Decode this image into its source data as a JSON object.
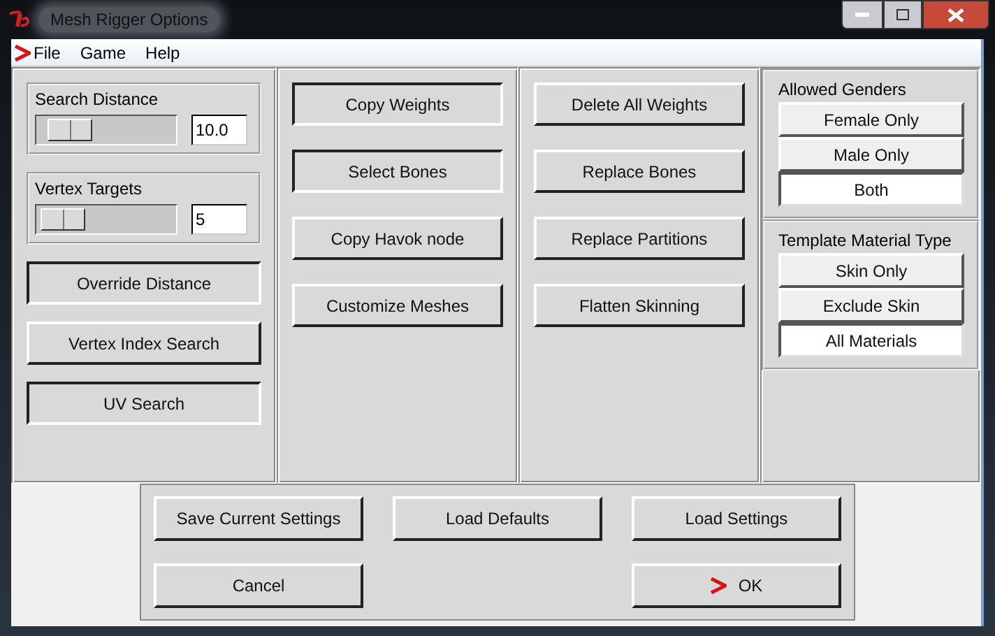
{
  "window": {
    "title": "Mesh Rigger Options"
  },
  "menu": [
    "File",
    "Game",
    "Help"
  ],
  "sliders": [
    {
      "label": "Search Distance",
      "value": "10.0"
    },
    {
      "label": "Vertex Targets",
      "value": "5"
    }
  ],
  "left_buttons": [
    {
      "label": "Override Distance",
      "pressed": true
    },
    {
      "label": "Vertex Index Search",
      "pressed": false
    },
    {
      "label": "UV Search",
      "pressed": true
    }
  ],
  "column_2": [
    {
      "label": "Copy Weights",
      "pressed": true
    },
    {
      "label": "Select Bones",
      "pressed": true
    },
    {
      "label": "Copy Havok node",
      "pressed": false
    },
    {
      "label": "Customize Meshes",
      "pressed": false
    }
  ],
  "column_3": [
    {
      "label": "Delete All Weights",
      "pressed": false
    },
    {
      "label": "Replace Bones",
      "pressed": false
    },
    {
      "label": "Replace Partitions",
      "pressed": false
    },
    {
      "label": "Flatten Skinning",
      "pressed": false
    }
  ],
  "option_groups": [
    {
      "title": "Allowed Genders",
      "options": [
        {
          "label": "Female Only",
          "selected": false
        },
        {
          "label": "Male Only",
          "selected": false
        },
        {
          "label": "Both",
          "selected": true
        }
      ]
    },
    {
      "title": "Template Material Type",
      "options": [
        {
          "label": "Skin Only",
          "selected": false
        },
        {
          "label": "Exclude Skin",
          "selected": false
        },
        {
          "label": "All Materials",
          "selected": true
        }
      ]
    }
  ],
  "bottom_buttons": [
    {
      "label": "Save Current Settings"
    },
    {
      "label": "Load Defaults"
    },
    {
      "label": "Load Settings"
    },
    {
      "label": "Cancel"
    },
    {
      "label": "OK"
    }
  ]
}
